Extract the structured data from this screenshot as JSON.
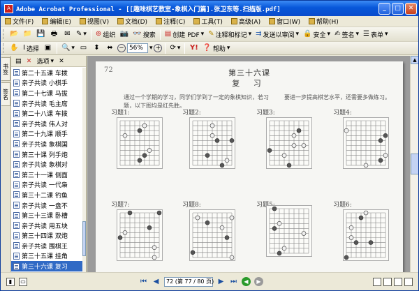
{
  "window": {
    "title": "Adobe Acrobat Professional - [[趣味棋艺教室-象棋入门篇].张卫东等.扫描版.pdf]"
  },
  "menu": [
    "文件(F)",
    "编辑(E)",
    "视图(V)",
    "文档(D)",
    "注释(C)",
    "工具(T)",
    "高级(A)",
    "窗口(W)",
    "帮助(H)"
  ],
  "toolbar1": {
    "tools": [
      {
        "icon": "open-icon",
        "glyph": "📂",
        "label": ""
      },
      {
        "icon": "folder-icon",
        "glyph": "📁",
        "label": ""
      },
      {
        "icon": "save-icon",
        "glyph": "💾",
        "label": ""
      },
      {
        "icon": "print-icon",
        "glyph": "🖶",
        "label": ""
      },
      {
        "icon": "email-icon",
        "glyph": "✉",
        "label": ""
      },
      {
        "icon": "search-icon",
        "glyph": "⌕",
        "label": ""
      },
      {
        "icon": "sign-icon",
        "glyph": "✎",
        "label": ""
      }
    ],
    "organize_label": "组织",
    "search_label": "搜索",
    "create_pdf_label": "创建 PDF",
    "comment_label": "注释和标记",
    "review_label": "发送以审阅",
    "secure_label": "安全",
    "sign_label": "签名",
    "forms_label": "表单"
  },
  "toolbar2": {
    "select_label": "选择",
    "zoom_value": "56%",
    "help_label": "帮助"
  },
  "nav_tabs": [
    "书签",
    "签名"
  ],
  "bookmarks_toolbar": {
    "options_label": "选项"
  },
  "bookmarks": [
    {
      "text": "第二十五课  车拨"
    },
    {
      "text": "亲子共读  小棋手"
    },
    {
      "text": "第二十七课  马拔"
    },
    {
      "text": "亲子共读  毛主席"
    },
    {
      "text": "第二十八课  车拨"
    },
    {
      "text": "亲子共读  伟人对"
    },
    {
      "text": "第二十九课  顺手"
    },
    {
      "text": "亲子共读  象棋国"
    },
    {
      "text": "第三十课  列手炮"
    },
    {
      "text": "亲子共读  象棋对"
    },
    {
      "text": "第三十一课  侧面"
    },
    {
      "text": "亲子共读  一代枭"
    },
    {
      "text": "第三十二课  钓鱼"
    },
    {
      "text": "亲子共读  一盘不"
    },
    {
      "text": "第三十三课  卧槽"
    },
    {
      "text": "亲子共读  用五块"
    },
    {
      "text": "第三十四课  双炮"
    },
    {
      "text": "亲子共读  围棋王"
    },
    {
      "text": "第三十五课  挂角"
    },
    {
      "text": "第三十六课  复习",
      "selected": true
    }
  ],
  "page": {
    "number": "72",
    "lesson_title": "第三十六课",
    "review_title": "复  习",
    "intro_left": "通过一个学期的学习，同学们学到了一定的象棋知识，若习题，以下图均是红先胜。",
    "intro_right": "要进一步提高棋艺水平，还需要多做练习。",
    "exercises": [
      "习题1:",
      "习题2:",
      "习题3:",
      "习题4:",
      "习题7:",
      "习题8:",
      "习题5:",
      "习题6:"
    ]
  },
  "status": {
    "page_display": "72 (第 77 / 80 页)"
  }
}
